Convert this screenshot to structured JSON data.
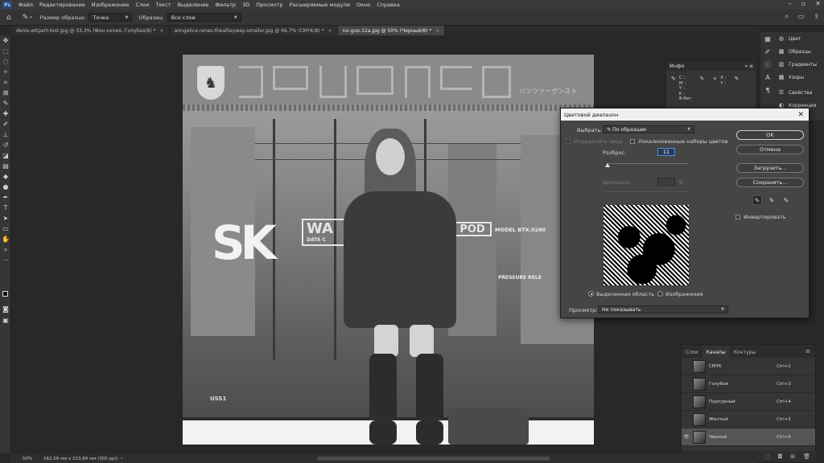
{
  "menubar": {
    "items": [
      "Файл",
      "Редактирование",
      "Изображение",
      "Слои",
      "Текст",
      "Выделение",
      "Фильтр",
      "3D",
      "Просмотр",
      "Расширяемые модули",
      "Окно",
      "Справка"
    ]
  },
  "options": {
    "sample_size_label": "Размер образца:",
    "sample_size_value": "Точка",
    "sample_label": "Образец:",
    "sample_value": "Все слои"
  },
  "tabs": [
    {
      "label": "denis-witpart-test.jpg @ 33,3% (Фон копия, Голубая/8) *"
    },
    {
      "label": "anngelica-renes-theallieyway-smaller.jpg @ 66,7% (CMYK/8) *"
    },
    {
      "label": "rui-guo-12a.jpg @ 50% (Черный/8) *"
    }
  ],
  "artwork": {
    "sk_text": "SK",
    "wa_text": "WA",
    "pod_text": "POD",
    "model_text": "MODEL BTX.0280",
    "pressure_text": "PRESSURE RELE",
    "data_text": "DATA C",
    "kana_text": "パンツァーグンスト",
    "ussl_text": "USS1"
  },
  "info_panel": {
    "title": "Инфо",
    "cmyk_keys": [
      "C :",
      "M :",
      "Y :",
      "K :",
      "8-бит"
    ],
    "xy_keys": [
      "X :",
      "Y :"
    ]
  },
  "right_panel": {
    "items": [
      {
        "icon": "color-icon",
        "label": "Цвет"
      },
      {
        "icon": "swatches-icon",
        "label": "Образцы"
      },
      {
        "icon": "gradients-icon",
        "label": "Градиенты"
      },
      {
        "icon": "patterns-icon",
        "label": "Узоры"
      },
      {
        "icon": "properties-icon",
        "label": "Свойства"
      },
      {
        "icon": "adjustments-icon",
        "label": "Коррекция"
      }
    ]
  },
  "dialog": {
    "title": "Цветовой диапазон",
    "select_label": "Выбрать:",
    "select_value": "По образцам",
    "detect_faces_label": "Определять лица",
    "localized_label": "Локализованные наборы цветов",
    "fuzziness_label": "Разброс:",
    "fuzziness_value": "11",
    "range_label": "Диапазон:",
    "range_unit": "%",
    "selection_radio": "Выделенная область",
    "image_radio": "Изображение",
    "preview_label": "Просмотр:",
    "preview_value": "Не показывать",
    "ok_label": "OK",
    "cancel_label": "Отмена",
    "load_label": "Загрузить...",
    "save_label": "Сохранить...",
    "invert_label": "Инвертировать",
    "fuzziness_fraction": 0.02
  },
  "layers_panel": {
    "tabs": [
      "Слои",
      "Каналы",
      "Контуры"
    ],
    "active_tab": "Каналы",
    "channels": [
      {
        "name": "CMYK",
        "key": "Ctrl+2",
        "visible": false
      },
      {
        "name": "Голубой",
        "key": "Ctrl+3",
        "visible": false
      },
      {
        "name": "Пурпурный",
        "key": "Ctrl+4",
        "visible": false
      },
      {
        "name": "Желтый",
        "key": "Ctrl+5",
        "visible": false
      },
      {
        "name": "Черный",
        "key": "Ctrl+6",
        "visible": true,
        "selected": true
      }
    ]
  },
  "status": {
    "zoom": "50%",
    "dimensions": "162,56 мм x 153,84 мм (300 ppi)"
  }
}
